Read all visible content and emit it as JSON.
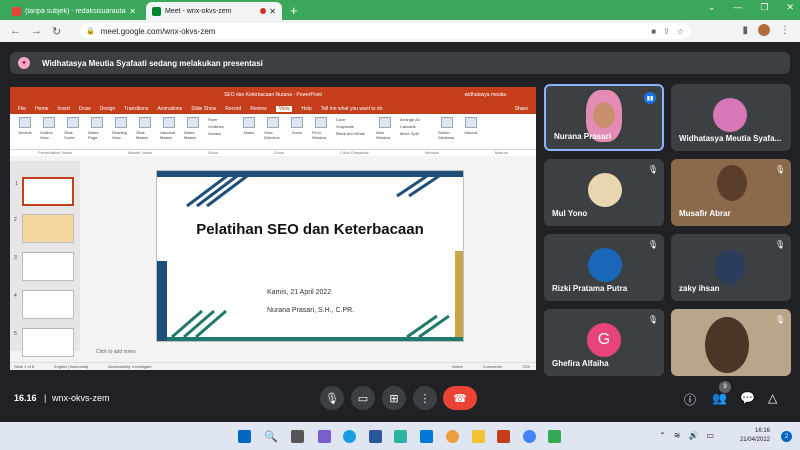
{
  "browser": {
    "tabs": [
      {
        "label": "(tanpa subjek) - redaksisuarautama",
        "active": false
      },
      {
        "label": "Meet - wnx-okvs-zem",
        "active": true
      }
    ],
    "new_tab": "+",
    "url": "meet.google.com/wnx-okvs-zem"
  },
  "meet": {
    "banner": "Widhatasya Meutia Syafaati sedang melakukan presentasi",
    "time": "16.16",
    "code": "wnx-okvs-zem",
    "participant_badge": "9",
    "participants": [
      {
        "name": "Nurana Prasari",
        "speaking": true
      },
      {
        "name": "Widhatasya Meutia Syafa...",
        "speaking": false
      },
      {
        "name": "Mul Yono",
        "speaking": false
      },
      {
        "name": "Musafir Abrar",
        "speaking": false
      },
      {
        "name": "Rizki Pratama Putra",
        "speaking": false
      },
      {
        "name": "zaky ihsan",
        "speaking": false
      },
      {
        "name": "Ghefira Alfaiha",
        "speaking": false,
        "initial": "G"
      },
      {
        "name": "",
        "speaking": false
      }
    ]
  },
  "powerpoint": {
    "title": "SEO dan Keterbacaan Nurana - PowerPoint",
    "user": "widhatasya meutia",
    "tabs": [
      "File",
      "Home",
      "Insert",
      "Draw",
      "Design",
      "Transitions",
      "Animations",
      "Slide Show",
      "Record",
      "Review",
      "View",
      "Help"
    ],
    "active_tab": "View",
    "tell_me": "Tell me what you want to do",
    "share": "Share",
    "ribbon_buttons": [
      "Normal",
      "Outline View",
      "Slide Sorter",
      "Notes Page",
      "Reading View",
      "Slide Master",
      "Handout Master",
      "Notes Master",
      "Notes",
      "View Direction",
      "Zoom",
      "Fit to Window",
      "New Window",
      "Switch Windows",
      "Macros"
    ],
    "ribbon_checks": [
      "Ruler",
      "Gridlines",
      "Guides"
    ],
    "color_options": [
      "Color",
      "Grayscale",
      "Black and White"
    ],
    "window_options": [
      "Arrange All",
      "Cascade",
      "Move Split"
    ],
    "ribbon_groups": [
      "Presentation Views",
      "Master Views",
      "Show",
      "Zoom",
      "Color/Grayscale",
      "Window",
      "Macros"
    ],
    "slide_numbers": [
      "1",
      "2",
      "3",
      "4",
      "5"
    ],
    "slide": {
      "title": "Pelatihan SEO dan Keterbacaan",
      "date": "Kamis, 21 April 2022",
      "author": "Nurana Prasari, S.H., C.PR."
    },
    "notes_placeholder": "Click to add notes",
    "status": [
      "Slide 1 of 8",
      "English (Indonesia)",
      "Accessibility: Investigate",
      "Notes",
      "Comments",
      "73%"
    ]
  },
  "taskbar": {
    "time": "16:16",
    "date": "21/04/2022",
    "notifications": "2"
  },
  "colors": {
    "meet_bg": "#202124",
    "tile_bg": "#3c4043",
    "accent": "#8ab4f8",
    "end_call": "#ea4335",
    "ppt_red": "#c43e1c",
    "tab_green": "#3aa75a"
  }
}
